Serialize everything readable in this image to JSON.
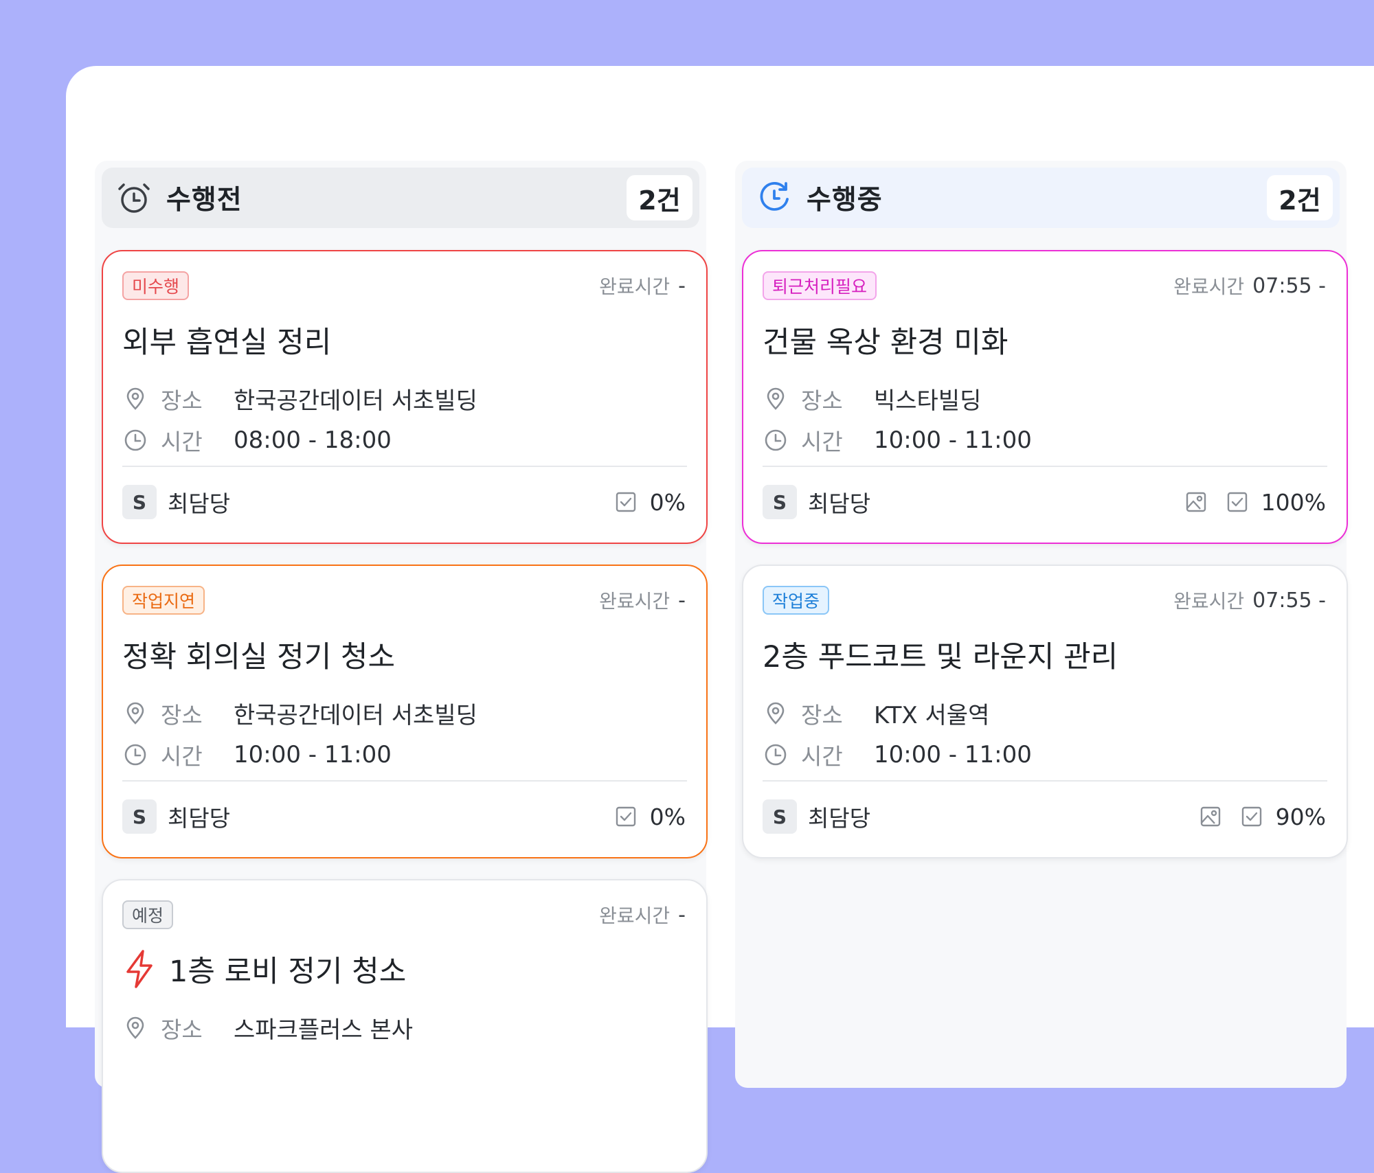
{
  "columns": [
    {
      "title": "수행전",
      "count": "2건",
      "cards": [
        {
          "badge": "미수행",
          "done_label": "완료시간",
          "done_value": "-",
          "title": "외부 흡연실 정리",
          "place_label": "장소",
          "place": "한국공간데이터 서초빌딩",
          "time_label": "시간",
          "time": "08:00 - 18:00",
          "avatar": "S",
          "owner": "최담당",
          "progress": "0%"
        },
        {
          "badge": "작업지연",
          "done_label": "완료시간",
          "done_value": "-",
          "title": "정확 회의실 정기 청소",
          "place_label": "장소",
          "place": "한국공간데이터 서초빌딩",
          "time_label": "시간",
          "time": "10:00 - 11:00",
          "avatar": "S",
          "owner": "최담당",
          "progress": "0%"
        },
        {
          "badge": "예정",
          "done_label": "완료시간",
          "done_value": "-",
          "title": "1층 로비 정기 청소",
          "place_label": "장소",
          "place": "스파크플러스 본사"
        }
      ]
    },
    {
      "title": "수행중",
      "count": "2건",
      "cards": [
        {
          "badge": "퇴근처리필요",
          "done_label": "완료시간",
          "done_value": "07:55 -",
          "title": "건물 옥상 환경 미화",
          "place_label": "장소",
          "place": "빅스타빌딩",
          "time_label": "시간",
          "time": "10:00 - 11:00",
          "avatar": "S",
          "owner": "최담당",
          "progress": "100%"
        },
        {
          "badge": "작업중",
          "done_label": "완료시간",
          "done_value": "07:55 -",
          "title": "2층 푸드코트 및 라운지 관리",
          "place_label": "장소",
          "place": "KTX 서울역",
          "time_label": "시간",
          "time": "10:00 - 11:00",
          "avatar": "S",
          "owner": "최담당",
          "progress": "90%"
        }
      ]
    }
  ],
  "colors": {
    "background": "#acb1fb",
    "missed": "#ef4444",
    "delayed": "#f97316",
    "checkout_needed": "#ec2fd6",
    "in_progress": "#1d7fd8",
    "in_progress_icon": "#2f80ed",
    "urgent_bolt": "#e53935"
  },
  "icons": [
    "alarm-clock-icon",
    "refresh-clock-icon",
    "location-pin-icon",
    "clock-icon",
    "checkbox-icon",
    "image-icon",
    "lightning-icon"
  ]
}
